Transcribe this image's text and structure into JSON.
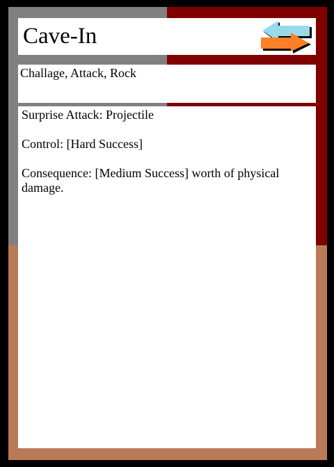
{
  "card": {
    "title": "Cave-In",
    "tags": "Challage, Attack, Rock",
    "lines": {
      "surprise_attack": "Surprise Attack: Projectile",
      "control": "Control: [Hard Success]",
      "consequence": "Consequence: [Medium Success] worth of physical damage."
    },
    "icon": "swap-arrows-icon"
  },
  "colors": {
    "frame": "#000000",
    "top_left": "#808080",
    "top_right": "#800000",
    "bottom": "#b97a57",
    "arrow_orange": "#ff7f27",
    "arrow_blue": "#99d9ea"
  }
}
